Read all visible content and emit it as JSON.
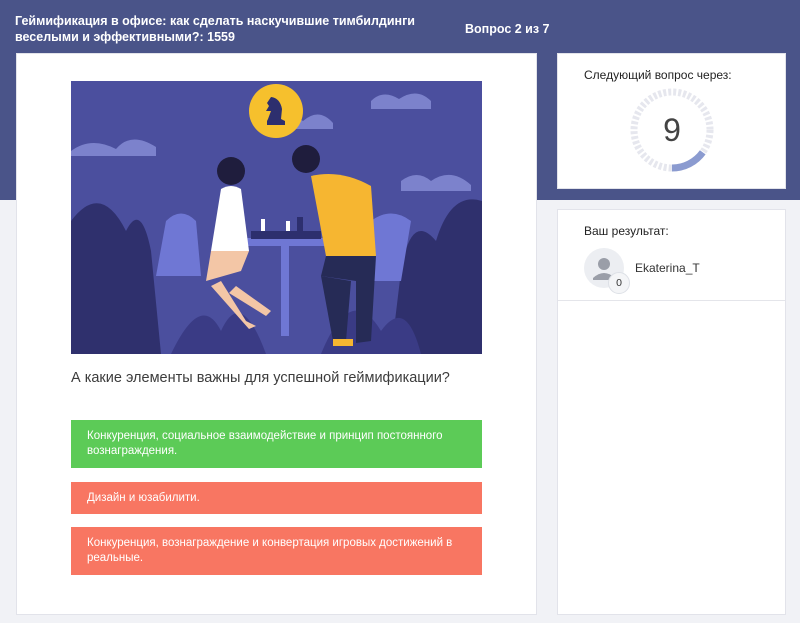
{
  "header": {
    "title": "Геймификация в офисе: как сделать наскучившие тимбилдинги веселыми и эффективными?: 1559",
    "counter": "Вопрос 2 из 7"
  },
  "question": {
    "image_icon": "chess-knight-icon",
    "text": "А какие элементы важны для успешной геймификации?",
    "answers": [
      {
        "text": "Конкуренция, социальное взаимодействие и принцип постоянного вознаграждения.",
        "status": "correct",
        "color": "#5ccb57"
      },
      {
        "text": "Дизайн и юзабилити.",
        "status": "wrong",
        "color": "#f87662"
      },
      {
        "text": "Конкуренция, вознаграждение и конвертация игровых достижений в реальные.",
        "status": "wrong",
        "color": "#f87662"
      }
    ]
  },
  "timer": {
    "label": "Следующий вопрос через:",
    "value": "9",
    "progress": 0.15
  },
  "results": {
    "label": "Ваш результат:",
    "users": [
      {
        "name": "Ekaterina_T",
        "score": "0",
        "avatar_icon": "user-icon"
      }
    ]
  },
  "colors": {
    "header_bg": "#4a5489",
    "correct": "#5ccb57",
    "wrong": "#f87662",
    "timer_accent": "#8b9bd0"
  }
}
